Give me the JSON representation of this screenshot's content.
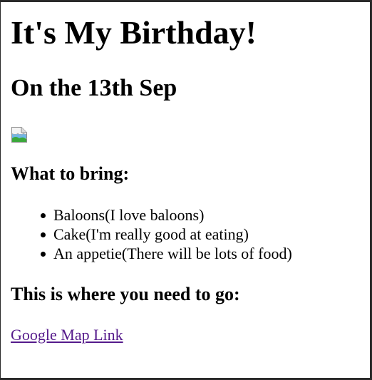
{
  "page": {
    "title": "It's My Birthday!",
    "date_heading": "On the 13th Sep"
  },
  "image": {
    "icon": "broken-image-icon"
  },
  "bring": {
    "heading": "What to bring:",
    "items": [
      {
        "label": "Baloons(I love baloons)"
      },
      {
        "label": "Cake(I'm really good at eating)"
      },
      {
        "label": "An appetie(There will be lots of food)"
      }
    ]
  },
  "location": {
    "heading": "This is where you need to go:",
    "link_label": "Google Map Link"
  },
  "colors": {
    "link_visited": "#551a8b",
    "text": "#000000",
    "background": "#ffffff"
  }
}
